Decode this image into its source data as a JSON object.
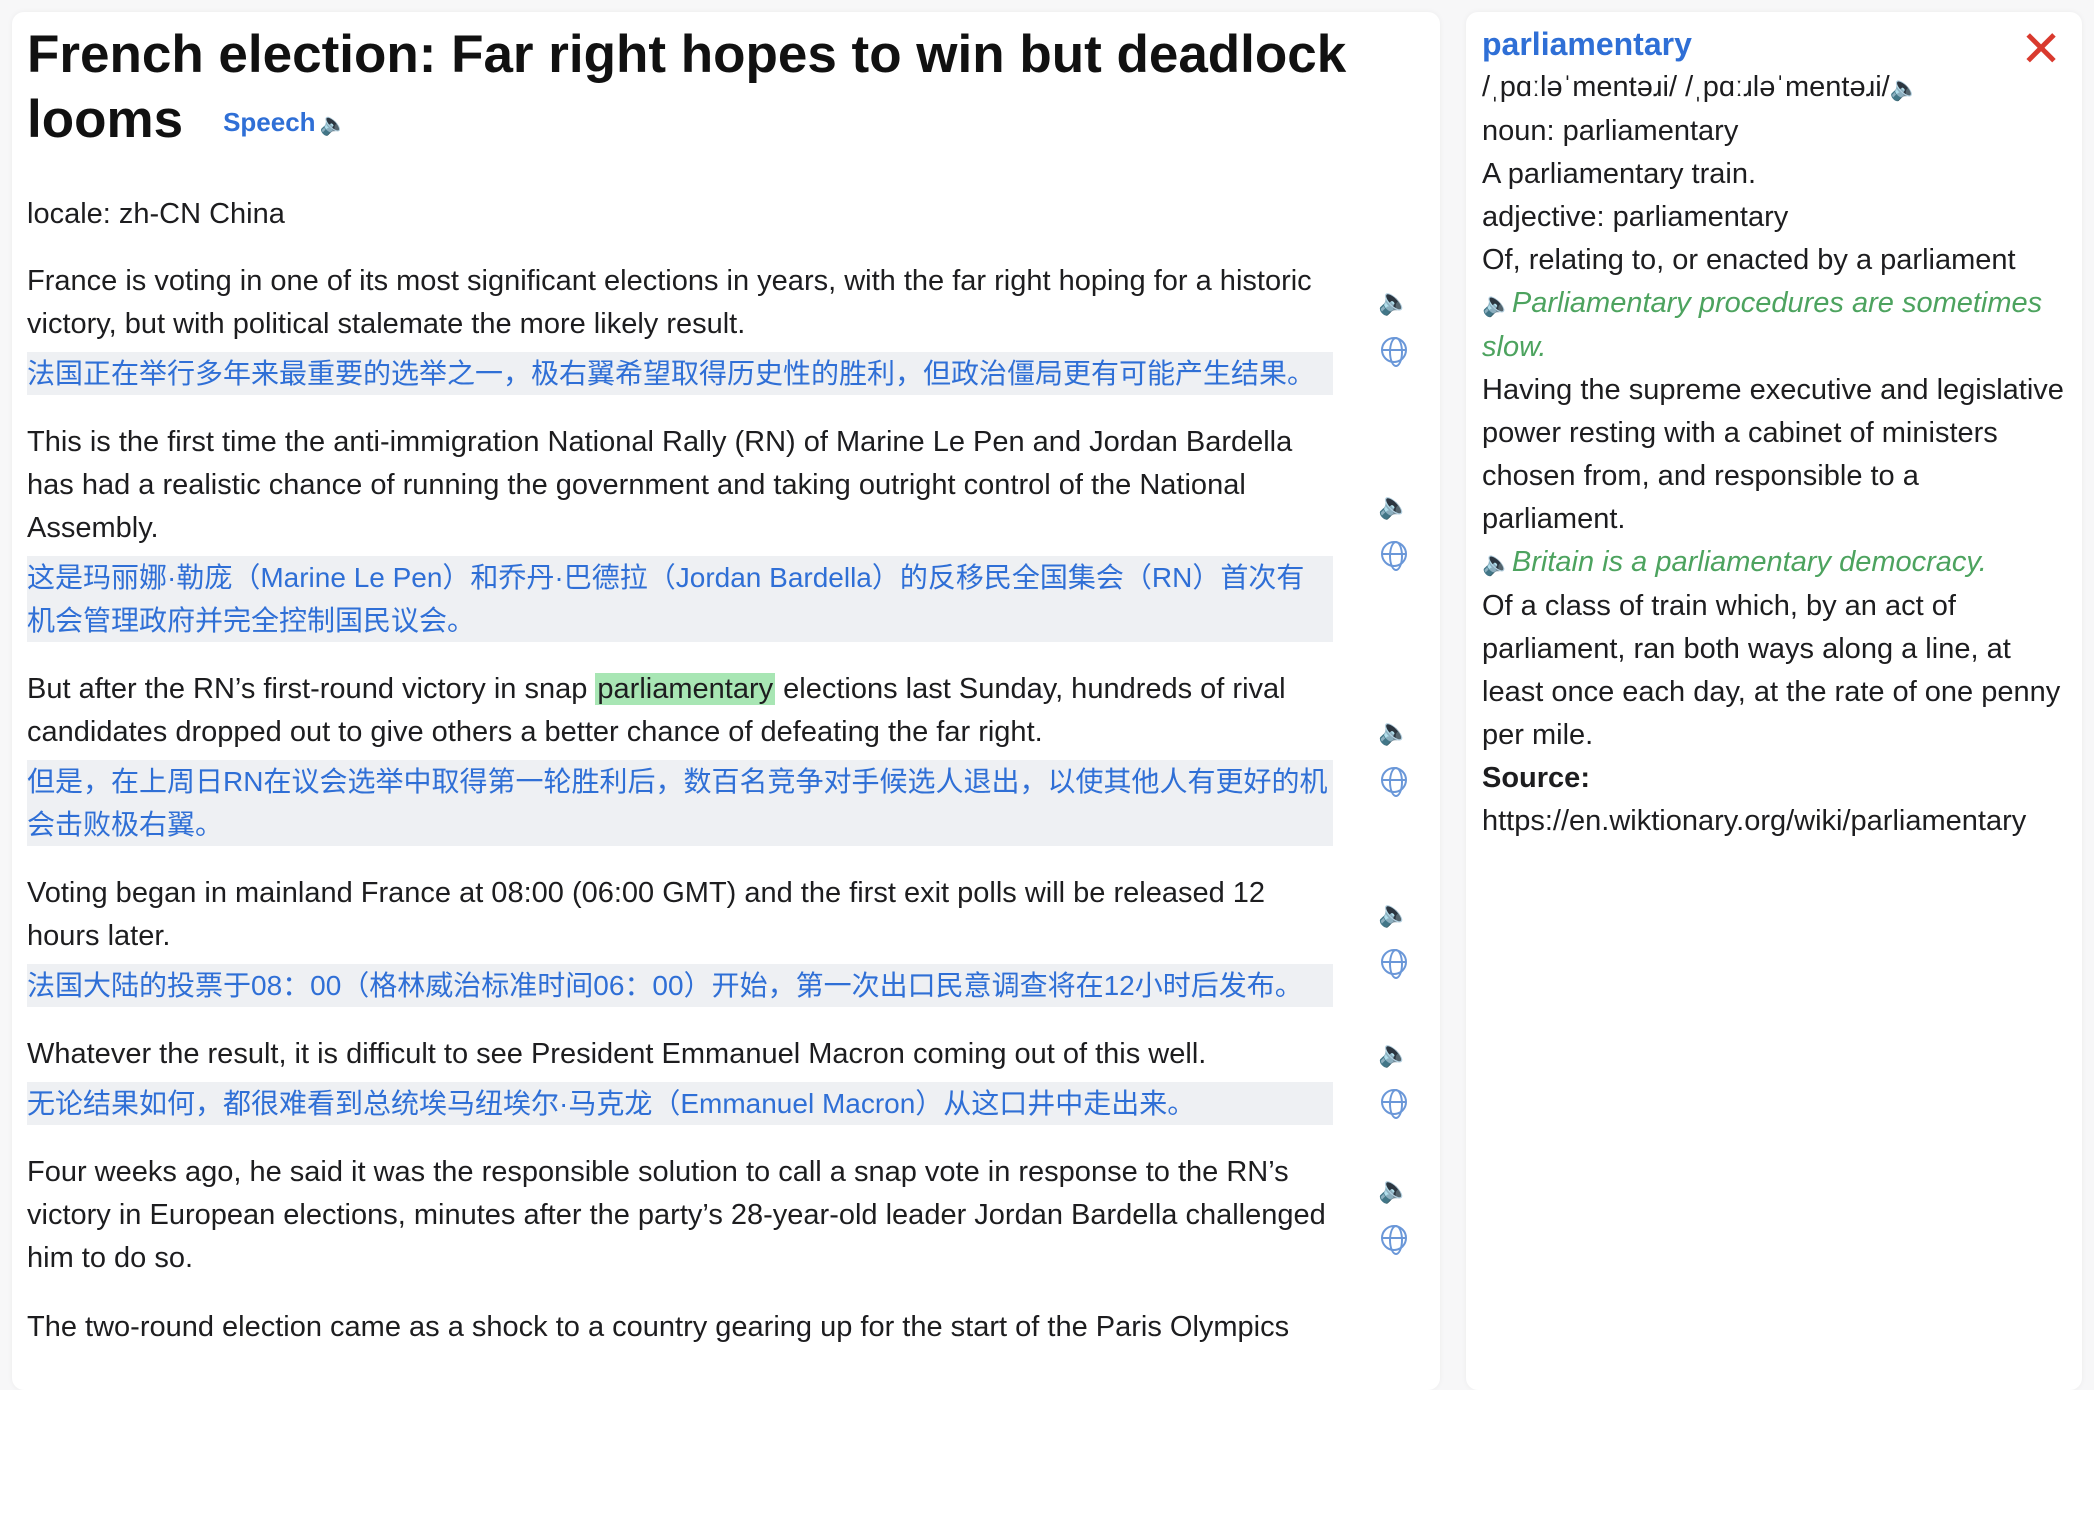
{
  "article": {
    "title": "French election: Far right hopes to win but deadlock looms",
    "speech_label": "Speech",
    "locale": "locale: zh-CN China",
    "paragraphs": [
      {
        "en": "France is voting in one of its most significant elections in years, with the far right hoping for a historic victory, but with political stalemate the more likely result.",
        "zh": "法国正在举行多年来最重要的选举之一，极右翼希望取得历史性的胜利，但政治僵局更有可能产生结果。"
      },
      {
        "en": "This is the first time the anti-immigration National Rally (RN) of Marine Le Pen and Jordan Bardella has had a realistic chance of running the government and taking outright control of the National Assembly.",
        "zh": "这是玛丽娜·勒庞（Marine Le Pen）和乔丹·巴德拉（Jordan Bardella）的反移民全国集会（RN）首次有机会管理政府并完全控制国民议会。"
      },
      {
        "en_before": "But after the RN’s first-round victory in snap ",
        "en_highlight": "parliamentary",
        "en_after": " elections last Sunday, hundreds of rival candidates dropped out to give others a better chance of defeating the far right.",
        "zh": "但是，在上周日RN在议会选举中取得第一轮胜利后，数百名竞争对手候选人退出，以使其他人有更好的机会击败极右翼。"
      },
      {
        "en": "Voting began in mainland France at 08:00 (06:00 GMT) and the first exit polls will be released 12 hours later.",
        "zh": "法国大陆的投票于08：00（格林威治标准时间06：00）开始，第一次出口民意调查将在12小时后发布。"
      },
      {
        "en": "Whatever the result, it is difficult to see President Emmanuel Macron coming out of this well.",
        "zh": "无论结果如何，都很难看到总统埃马纽埃尔·马克龙（Emmanuel Macron）从这口井中走出来。"
      },
      {
        "en": "Four weeks ago, he said it was the responsible solution to call a snap vote in response to the RN’s victory in European elections, minutes after the party’s 28-year-old leader Jordan Bardella challenged him to do so.",
        "zh": ""
      },
      {
        "en": "The two-round election came as a shock to a country gearing up for the start of the Paris Olympics",
        "zh": ""
      }
    ],
    "speaker_icon": "speaker-icon",
    "translate_icon": "globe-icon"
  },
  "dictionary": {
    "word": "parliamentary",
    "pronunciation": "/ˌpɑːləˈmentəɹi/  /ˌpɑːɹləˈmentəɹi/",
    "noun_label": "noun: parliamentary",
    "noun_def": "A parliamentary train.",
    "adj_label": "adjective: parliamentary",
    "adj_def1": "Of, relating to, or enacted by a parliament",
    "adj_example1": "Parliamentary procedures are sometimes slow.",
    "adj_def2": "Having the supreme executive and legislative power resting with a cabinet of ministers chosen from, and responsible to a parliament.",
    "adj_example2": "Britain is a parliamentary democracy.",
    "adj_def3": "Of a class of train which, by an act of parliament, ran both ways along a line, at least once each day, at the rate of one penny per mile.",
    "source_label": "Source:",
    "source_url": "https://en.wiktionary.org/wiki/parliamentary",
    "close_label": "✕"
  },
  "colors": {
    "accent": "#2f6fd6",
    "highlight": "#a8e6b4",
    "example": "#4da35f",
    "close": "#d93a2e"
  }
}
